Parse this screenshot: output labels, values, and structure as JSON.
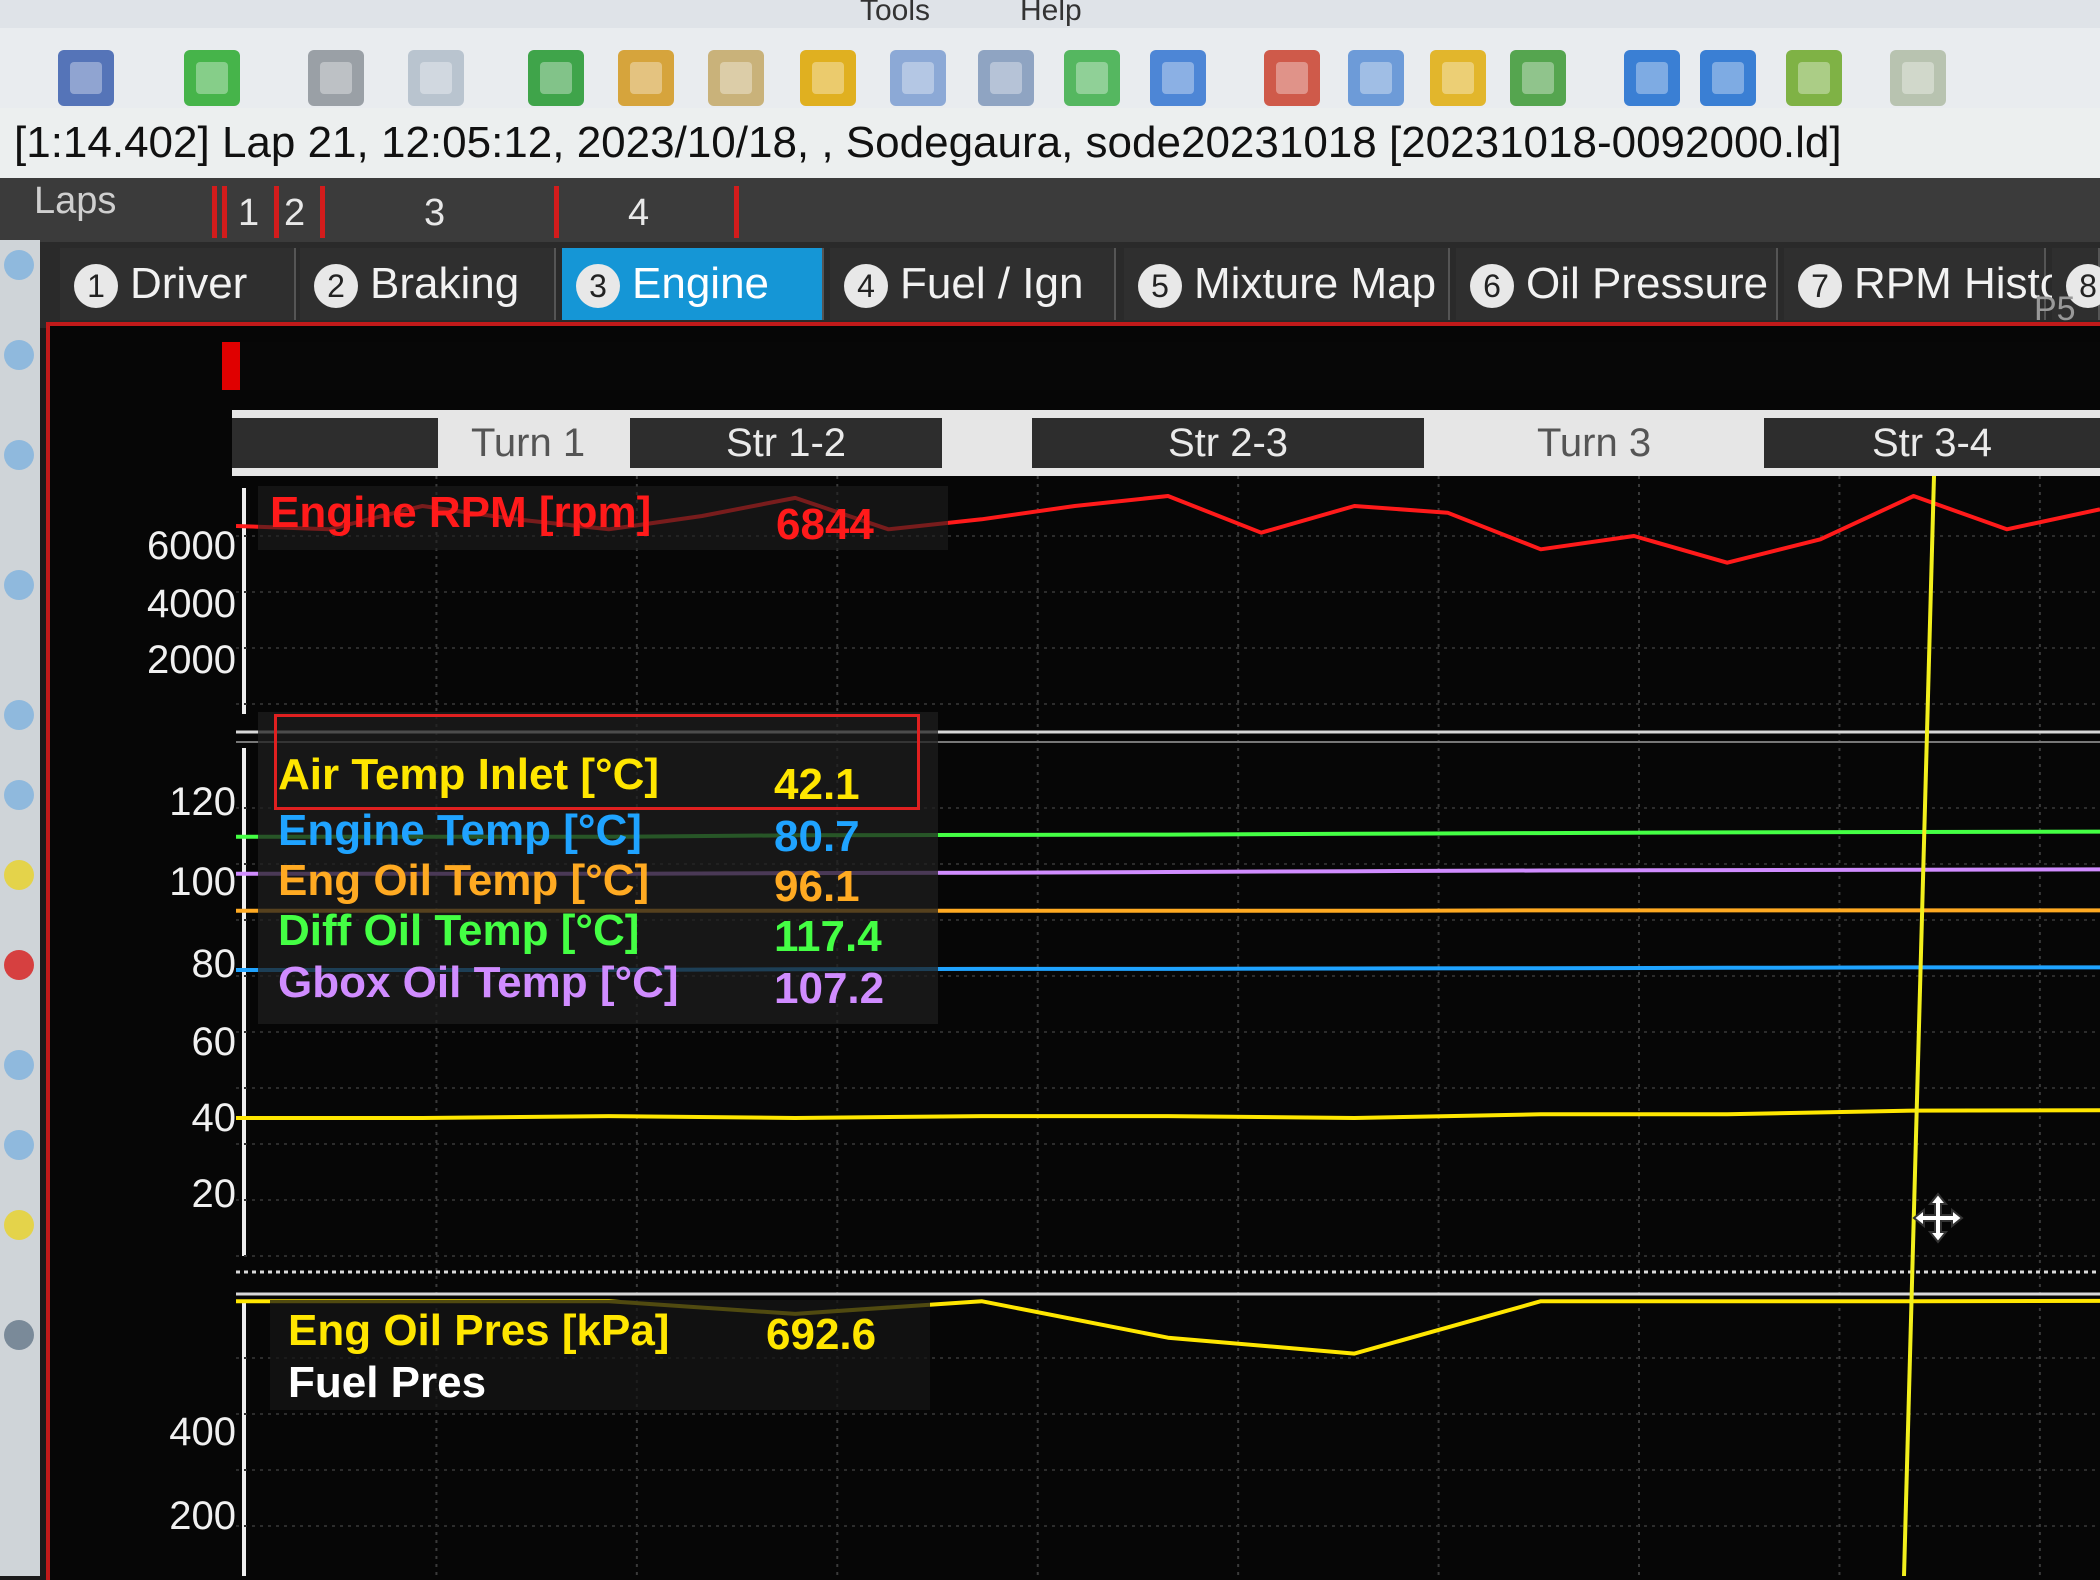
{
  "menu": {
    "items": [
      "Tools",
      "Help"
    ]
  },
  "toolbar": {
    "icons": [
      "save-icon",
      "download-icon",
      "print-icon",
      "print-preview-icon",
      "refresh-icon",
      "flag-icon",
      "edit-icon",
      "film-icon",
      "calculator-icon",
      "list-icon",
      "checklist-icon",
      "ruler-icon",
      "grid-icon",
      "clock-icon",
      "layers-icon",
      "track-icon",
      "nav-back-icon",
      "nav-forward-icon",
      "marker-icon",
      "zoom-icon"
    ]
  },
  "info": {
    "text": "[1:14.402] Lap 21, 12:05:12, 2023/10/18,  , Sodegaura, sode20231018 [20231018-0092000.ld]"
  },
  "laps": {
    "label": "Laps",
    "numbers": [
      "1",
      "2",
      "3",
      "4"
    ]
  },
  "tabs": [
    {
      "num": "1",
      "label": "Driver"
    },
    {
      "num": "2",
      "label": "Braking"
    },
    {
      "num": "3",
      "label": "Engine"
    },
    {
      "num": "4",
      "label": "Fuel / Ign"
    },
    {
      "num": "5",
      "label": "Mixture Map"
    },
    {
      "num": "6",
      "label": "Oil Pressure"
    },
    {
      "num": "7",
      "label": "RPM Histo"
    },
    {
      "num": "8",
      "label": ""
    }
  ],
  "page_label": "P5",
  "sectors": [
    "",
    "Turn 1",
    "Str 1-2",
    "",
    "Str 2-3",
    "Turn 3",
    "Str 3-4"
  ],
  "axes": {
    "rpm_ticks": [
      "6000",
      "4000",
      "2000"
    ],
    "temp_ticks": [
      "120",
      "100",
      "80",
      "60",
      "40",
      "20"
    ],
    "pres_ticks": [
      "400",
      "200"
    ]
  },
  "legends": {
    "rpm": {
      "name": "Engine RPM [rpm]",
      "value": "6844",
      "color": "#ff1a1a"
    },
    "temps": [
      {
        "name": "Air Temp Inlet [°C]",
        "value": "42.1",
        "color": "#ffe600"
      },
      {
        "name": "Engine Temp [°C]",
        "value": "80.7",
        "color": "#1fa3ff"
      },
      {
        "name": "Eng Oil Temp [°C]",
        "value": "96.1",
        "color": "#ffaa22"
      },
      {
        "name": "Diff Oil Temp [°C]",
        "value": "117.4",
        "color": "#44ff44"
      },
      {
        "name": "Gbox Oil Temp [°C]",
        "value": "107.2",
        "color": "#d08cff"
      }
    ],
    "pres": [
      {
        "name": "Eng Oil Pres [kPa]",
        "value": "692.6",
        "color": "#ffe600"
      },
      {
        "name": "Fuel Pres",
        "value": "",
        "color": "#ffffff"
      }
    ]
  },
  "colors": {
    "accent_tab": "#1596d6",
    "cursor": "#f2ef1c",
    "frame": "#c01a1a"
  },
  "chart_data": [
    {
      "type": "line",
      "ylabel": "Engine RPM [rpm]",
      "ylim": [
        0,
        7500
      ],
      "x": [
        0,
        50,
        100,
        150,
        200,
        250,
        300,
        350,
        400,
        450,
        500,
        550,
        600,
        650,
        700,
        750,
        800,
        850,
        900,
        950,
        1000
      ],
      "series": [
        {
          "name": "Engine RPM [rpm]",
          "values": [
            6000,
            5900,
            6600,
            6200,
            5900,
            6300,
            6844,
            5900,
            6200,
            6600,
            6900,
            5800,
            6600,
            6400,
            5300,
            5700,
            4900,
            5600,
            6900,
            5900,
            6500
          ]
        }
      ]
    },
    {
      "type": "line",
      "ylim": [
        0,
        140
      ],
      "x": [
        0,
        100,
        200,
        300,
        400,
        500,
        600,
        700,
        800,
        900,
        1000
      ],
      "series": [
        {
          "name": "Air Temp Inlet [°C]",
          "values": [
            40,
            40,
            40.5,
            40,
            40.5,
            40.5,
            40,
            41,
            41,
            42,
            42.1
          ]
        },
        {
          "name": "Engine Temp [°C]",
          "values": [
            80,
            80,
            80,
            80.2,
            80.3,
            80.3,
            80.4,
            80.5,
            80.6,
            80.7,
            80.7
          ]
        },
        {
          "name": "Eng Oil Temp [°C]",
          "values": [
            96,
            96,
            96,
            96,
            96,
            96,
            96,
            96.1,
            96.1,
            96.1,
            96.1
          ]
        },
        {
          "name": "Diff Oil Temp [°C]",
          "values": [
            116,
            116,
            116,
            116.4,
            116.5,
            116.6,
            116.8,
            117,
            117.2,
            117.3,
            117.4
          ]
        },
        {
          "name": "Gbox Oil Temp [°C]",
          "values": [
            106,
            106,
            106,
            106.2,
            106.3,
            106.5,
            106.7,
            106.9,
            107.0,
            107.1,
            107.2
          ]
        }
      ]
    },
    {
      "type": "line",
      "ylim": [
        0,
        700
      ],
      "x": [
        0,
        100,
        200,
        300,
        400,
        500,
        600,
        700,
        800,
        900,
        1000
      ],
      "series": [
        {
          "name": "Eng Oil Pres [kPa]",
          "values": [
            692,
            692,
            692,
            660,
            692,
            600,
            560,
            692,
            692,
            692,
            692.6
          ]
        }
      ]
    }
  ]
}
